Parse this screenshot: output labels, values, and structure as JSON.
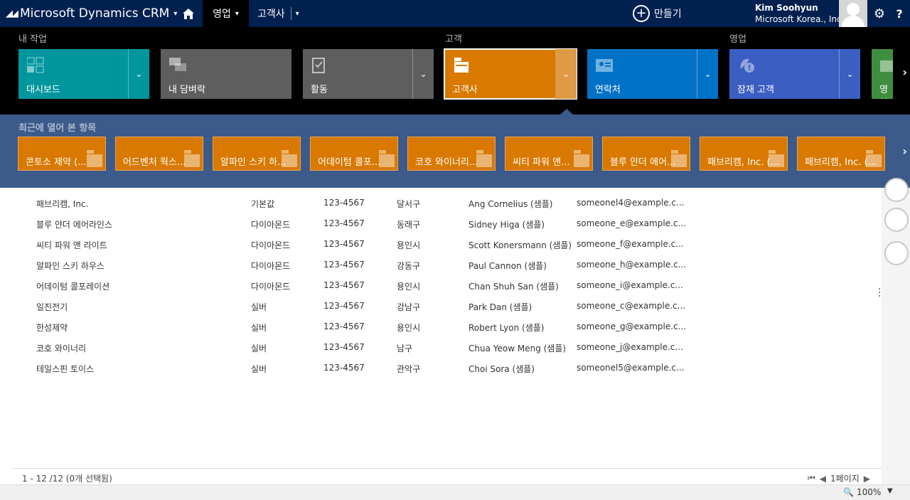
{
  "topbar": {
    "brand": "Microsoft Dynamics CRM",
    "nav_sales": "영업",
    "nav_accounts": "고객사",
    "create": "만들기",
    "user_name": "Kim Soohyun",
    "user_org": "Microsoft Korea., Inc"
  },
  "nav": {
    "group_my_work": "내 작업",
    "group_customers": "고객",
    "group_sales": "영업",
    "tiles": [
      {
        "label": "대시보드",
        "color": "#00969e",
        "icon": "dashboard-icon"
      },
      {
        "label": "내 담벼락",
        "color": "#5e5e5e",
        "icon": "wall-icon"
      },
      {
        "label": "활동",
        "color": "#5e5e5e",
        "icon": "activity-icon"
      },
      {
        "label": "고객사",
        "color": "#d97900",
        "icon": "account-icon"
      },
      {
        "label": "연락처",
        "color": "#0072c6",
        "icon": "contact-icon"
      },
      {
        "label": "잠재 고객",
        "color": "#3a5ec2",
        "icon": "lead-icon"
      },
      {
        "label": "영업",
        "color": "#3f8e3f",
        "icon": "opportunity-icon"
      }
    ]
  },
  "recent": {
    "label": "최근에 열어 본 항목",
    "items": [
      "콘토소 제약 (...",
      "어드벤처 웍스...",
      "알파인 스키 하...",
      "어데이텀 콜포...",
      "코호 와이너리...",
      "씨티 파워 앤...",
      "블루 얀더 에어...",
      "패브리캠, Inc. (...",
      "패브리캠, Inc. (..."
    ]
  },
  "rows": [
    [
      "패브리캠, Inc.",
      "기본값",
      "123-4567",
      "달서구",
      "Ang Cornelius (샘플)",
      "someonel4@example.c..."
    ],
    [
      "블루 얀더 에어라인스",
      "다이아몬드",
      "123-4567",
      "동래구",
      "Sidney Higa (샘플)",
      "someone_e@example.c..."
    ],
    [
      "씨티 파워 앤 라이트",
      "다이아몬드",
      "123-4567",
      "용인시",
      "Scott Konersmann (샘플)",
      "someone_f@example.c..."
    ],
    [
      "알파인 스키 하우스",
      "다이아몬드",
      "123-4567",
      "강동구",
      "Paul Cannon (샘플)",
      "someone_h@example.c..."
    ],
    [
      "어데이텀 콜포레이션",
      "다이아몬드",
      "123-4567",
      "용인시",
      "Chan Shuh San (샘플)",
      "someone_i@example.c..."
    ],
    [
      "일진전기",
      "실버",
      "123-4567",
      "강남구",
      "Park Dan (샘플)",
      "someone_c@example.c..."
    ],
    [
      "한성제약",
      "실버",
      "123-4567",
      "용인시",
      "Robert Lyon (샘플)",
      "someone_g@example.c..."
    ],
    [
      "코호 와이너리",
      "실버",
      "123-4567",
      "남구",
      "Chua Yeow Meng (샘플)",
      "someone_j@example.c..."
    ],
    [
      "테일스핀 토이스",
      "실버",
      "123-4567",
      "관악구",
      "Choi Sora (샘플)",
      "someonel5@example.c..."
    ]
  ],
  "footer": {
    "count": "1 - 12 /12 (0개 선택됨)",
    "page": "1페이지"
  },
  "status": {
    "zoom": "100%"
  },
  "colors": {
    "topbar": "#002050",
    "recent_bar": "#3c5a8a",
    "recent_tile": "#d97900"
  }
}
